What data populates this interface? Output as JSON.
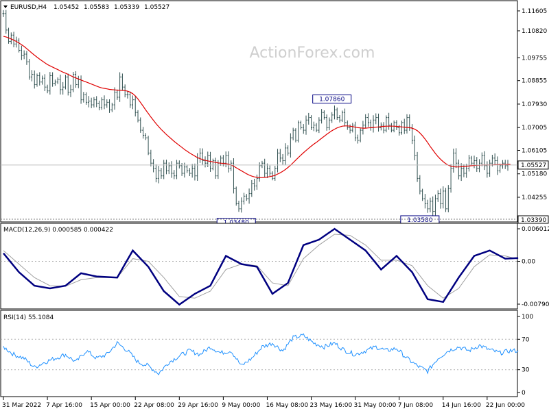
{
  "header": {
    "symbol": "EURUSD,H4",
    "open": "1.05452",
    "high": "1.05583",
    "low": "1.05339",
    "close": "1.05527"
  },
  "watermark": "ActionForex.com",
  "colors": {
    "candle": "#2f4f4f",
    "ma": "#e00000",
    "macd": "#000080",
    "macd_signal": "#a0a0a0",
    "rsi": "#1e90ff",
    "grid_dash": "#b0b0b0",
    "label_box": "#000080"
  },
  "chart_data": [
    {
      "type": "candlestick",
      "name": "price",
      "y_ticks": [
        "1.11605",
        "1.10820",
        "1.09755",
        "1.08855",
        "1.07930",
        "1.07005",
        "1.06105",
        "1.05180",
        "1.04255",
        "1.03390"
      ],
      "ylim": [
        1.0339,
        1.119
      ],
      "current_price": "1.05527",
      "annotations": [
        {
          "label": "1.07860",
          "x_index": 127,
          "value": 1.0786
        },
        {
          "label": "1.03480",
          "x_index": 90,
          "value": 1.0348
        },
        {
          "label": "1.03580",
          "x_index": 161,
          "value": 1.0358
        }
      ],
      "close": [
        1.115,
        1.1085,
        1.104,
        1.1065,
        1.103,
        1.1045,
        1.1005,
        1.0985,
        1.099,
        1.096,
        1.09,
        1.091,
        1.087,
        1.0905,
        1.088,
        1.0895,
        1.086,
        1.0845,
        1.0905,
        1.0875,
        1.088,
        1.089,
        1.085,
        1.086,
        1.09,
        1.084,
        1.085,
        1.091,
        1.087,
        1.089,
        1.081,
        1.083,
        1.08,
        1.0805,
        1.079,
        1.081,
        1.0795,
        1.078,
        1.081,
        1.079,
        1.08,
        1.077,
        1.079,
        1.084,
        1.082,
        1.09,
        1.086,
        1.083,
        1.083,
        1.079,
        1.081,
        1.076,
        1.073,
        1.069,
        1.067,
        1.066,
        1.06,
        1.056,
        1.054,
        1.05,
        1.053,
        1.051,
        1.056,
        1.053,
        1.055,
        1.052,
        1.051,
        1.056,
        1.055,
        1.052,
        1.0545,
        1.053,
        1.052,
        1.054,
        1.051,
        1.058,
        1.06,
        1.057,
        1.056,
        1.059,
        1.054,
        1.057,
        1.051,
        1.056,
        1.058,
        1.056,
        1.059,
        1.054,
        1.056,
        1.046,
        1.04,
        1.038,
        1.041,
        1.043,
        1.042,
        1.044,
        1.048,
        1.047,
        1.05,
        1.055,
        1.056,
        1.052,
        1.054,
        1.052,
        1.05,
        1.054,
        1.06,
        1.058,
        1.057,
        1.062,
        1.06,
        1.066,
        1.069,
        1.065,
        1.072,
        1.07,
        1.069,
        1.073,
        1.074,
        1.07,
        1.071,
        1.069,
        1.073,
        1.076,
        1.074,
        1.07,
        1.073,
        1.075,
        1.077,
        1.074,
        1.073,
        1.076,
        1.072,
        1.07,
        1.069,
        1.071,
        1.066,
        1.065,
        1.069,
        1.071,
        1.074,
        1.072,
        1.07,
        1.073,
        1.074,
        1.07,
        1.071,
        1.069,
        1.074,
        1.071,
        1.069,
        1.072,
        1.07,
        1.068,
        1.072,
        1.069,
        1.074,
        1.07,
        1.065,
        1.059,
        1.05,
        1.045,
        1.042,
        1.04,
        1.038,
        1.041,
        1.037,
        1.042,
        1.044,
        1.04,
        1.045,
        1.038,
        1.046,
        1.054,
        1.06,
        1.056,
        1.051,
        1.054,
        1.052,
        1.054,
        1.058,
        1.056,
        1.057,
        1.054,
        1.056,
        1.059,
        1.055,
        1.052,
        1.056,
        1.058,
        1.057,
        1.053,
        1.055,
        1.056,
        1.055,
        1.0553
      ],
      "ma": [
        1.106,
        1.1058,
        1.1054,
        1.105,
        1.1045,
        1.104,
        1.1034,
        1.1027,
        1.102,
        1.1012,
        1.1003,
        1.0994,
        1.0986,
        1.0978,
        1.097,
        1.0963,
        1.0956,
        1.0949,
        1.0944,
        1.0939,
        1.0934,
        1.0929,
        1.0924,
        1.0919,
        1.0915,
        1.091,
        1.0905,
        1.09,
        1.0896,
        1.0892,
        1.0888,
        1.0884,
        1.088,
        1.0876,
        1.0872,
        1.0868,
        1.0864,
        1.086,
        1.0857,
        1.0855,
        1.0853,
        1.0851,
        1.085,
        1.0849,
        1.0848,
        1.0848,
        1.0847,
        1.0846,
        1.0844,
        1.084,
        1.0834,
        1.0825,
        1.0813,
        1.0799,
        1.0785,
        1.077,
        1.0756,
        1.0742,
        1.0729,
        1.0716,
        1.0704,
        1.0693,
        1.0683,
        1.0673,
        1.0664,
        1.0655,
        1.0646,
        1.0638,
        1.063,
        1.0622,
        1.0614,
        1.0607,
        1.06,
        1.0594,
        1.0588,
        1.0582,
        1.0578,
        1.0574,
        1.0571,
        1.0569,
        1.0567,
        1.0565,
        1.0563,
        1.0561,
        1.056,
        1.0559,
        1.0558,
        1.0556,
        1.0553,
        1.0548,
        1.0542,
        1.0536,
        1.053,
        1.0524,
        1.0518,
        1.0513,
        1.0509,
        1.0506,
        1.0504,
        1.0503,
        1.0503,
        1.0504,
        1.0505,
        1.0507,
        1.0509,
        1.0512,
        1.0517,
        1.0522,
        1.0528,
        1.0535,
        1.0543,
        1.0552,
        1.0562,
        1.0572,
        1.0582,
        1.0592,
        1.0601,
        1.061,
        1.0619,
        1.0627,
        1.0635,
        1.0642,
        1.065,
        1.0658,
        1.0666,
        1.0674,
        1.0681,
        1.0688,
        1.0694,
        1.0699,
        1.0703,
        1.0706,
        1.0707,
        1.0707,
        1.0706,
        1.0704,
        1.0702,
        1.07,
        1.0699,
        1.0698,
        1.0698,
        1.0699,
        1.07,
        1.0701,
        1.0702,
        1.0703,
        1.0704,
        1.0705,
        1.0706,
        1.0706,
        1.0706,
        1.0706,
        1.0705,
        1.0704,
        1.0703,
        1.0702,
        1.0701,
        1.07,
        1.0698,
        1.0694,
        1.0688,
        1.0679,
        1.0668,
        1.0655,
        1.0641,
        1.0626,
        1.0612,
        1.0598,
        1.0586,
        1.0575,
        1.0566,
        1.0558,
        1.0552,
        1.0548,
        1.0546,
        1.0545,
        1.0545,
        1.0546,
        1.0547,
        1.0548,
        1.0549,
        1.055,
        1.0551,
        1.0552,
        1.0552,
        1.0553,
        1.0553,
        1.0553,
        1.0553,
        1.0553,
        1.0554,
        1.0554,
        1.0554,
        1.0554,
        1.0554,
        1.0555,
        1.0555
      ]
    },
    {
      "type": "line",
      "name": "MACD(12,26,9) 0.000585 0.000422",
      "ylim": [
        -0.007907,
        0.006012
      ],
      "y_ticks": [
        "0.006012",
        "0.00",
        "-0.007907"
      ],
      "macd_points": [
        [
          0,
          0.0015
        ],
        [
          6,
          -0.002
        ],
        [
          12,
          -0.0045
        ],
        [
          18,
          -0.005
        ],
        [
          24,
          -0.0045
        ],
        [
          30,
          -0.0022
        ],
        [
          36,
          -0.0028
        ],
        [
          44,
          -0.003
        ],
        [
          50,
          0.002
        ],
        [
          56,
          -0.001
        ],
        [
          62,
          -0.0055
        ],
        [
          68,
          -0.008
        ],
        [
          74,
          -0.006
        ],
        [
          80,
          -0.0045
        ],
        [
          86,
          0.001
        ],
        [
          92,
          -0.0005
        ],
        [
          98,
          -0.001
        ],
        [
          104,
          -0.006
        ],
        [
          110,
          -0.004
        ],
        [
          116,
          0.003
        ],
        [
          122,
          0.004
        ],
        [
          128,
          0.006
        ],
        [
          134,
          0.004
        ],
        [
          140,
          0.002
        ],
        [
          146,
          -0.0015
        ],
        [
          152,
          0.001
        ],
        [
          158,
          -0.002
        ],
        [
          164,
          -0.007
        ],
        [
          170,
          -0.0075
        ],
        [
          176,
          -0.003
        ],
        [
          182,
          0.001
        ],
        [
          188,
          0.002
        ],
        [
          194,
          0.0005
        ],
        [
          199,
          0.0006
        ]
      ],
      "signal_points": [
        [
          0,
          0.002
        ],
        [
          6,
          -0.0005
        ],
        [
          12,
          -0.003
        ],
        [
          18,
          -0.0045
        ],
        [
          24,
          -0.0046
        ],
        [
          30,
          -0.0034
        ],
        [
          36,
          -0.003
        ],
        [
          44,
          -0.003
        ],
        [
          50,
          0.0005
        ],
        [
          56,
          0.0
        ],
        [
          62,
          -0.003
        ],
        [
          68,
          -0.0065
        ],
        [
          74,
          -0.0068
        ],
        [
          80,
          -0.0055
        ],
        [
          86,
          -0.0015
        ],
        [
          92,
          -0.0005
        ],
        [
          98,
          -0.0008
        ],
        [
          104,
          -0.004
        ],
        [
          110,
          -0.0045
        ],
        [
          116,
          0.0005
        ],
        [
          122,
          0.003
        ],
        [
          128,
          0.005
        ],
        [
          134,
          0.0048
        ],
        [
          140,
          0.003
        ],
        [
          146,
          0.0002
        ],
        [
          152,
          0.0002
        ],
        [
          158,
          -0.0008
        ],
        [
          164,
          -0.0045
        ],
        [
          170,
          -0.0068
        ],
        [
          176,
          -0.005
        ],
        [
          182,
          -0.001
        ],
        [
          188,
          0.0012
        ],
        [
          194,
          0.001
        ],
        [
          199,
          0.0004
        ]
      ]
    },
    {
      "type": "line",
      "name": "RSI(14) 55.1084",
      "ylim": [
        0,
        100
      ],
      "y_ticks": [
        "100",
        "70",
        "30",
        "0"
      ],
      "levels": [
        70,
        30
      ],
      "points": [
        [
          0,
          60
        ],
        [
          4,
          50
        ],
        [
          8,
          45
        ],
        [
          12,
          33
        ],
        [
          16,
          40
        ],
        [
          20,
          45
        ],
        [
          24,
          50
        ],
        [
          28,
          40
        ],
        [
          32,
          55
        ],
        [
          36,
          45
        ],
        [
          40,
          50
        ],
        [
          44,
          65
        ],
        [
          48,
          55
        ],
        [
          52,
          40
        ],
        [
          56,
          35
        ],
        [
          60,
          25
        ],
        [
          64,
          40
        ],
        [
          68,
          48
        ],
        [
          72,
          55
        ],
        [
          76,
          50
        ],
        [
          80,
          60
        ],
        [
          84,
          52
        ],
        [
          88,
          55
        ],
        [
          92,
          35
        ],
        [
          96,
          45
        ],
        [
          100,
          60
        ],
        [
          104,
          65
        ],
        [
          108,
          55
        ],
        [
          112,
          72
        ],
        [
          116,
          75
        ],
        [
          120,
          65
        ],
        [
          124,
          60
        ],
        [
          128,
          65
        ],
        [
          132,
          55
        ],
        [
          136,
          50
        ],
        [
          140,
          55
        ],
        [
          144,
          60
        ],
        [
          148,
          55
        ],
        [
          152,
          58
        ],
        [
          156,
          45
        ],
        [
          160,
          35
        ],
        [
          164,
          28
        ],
        [
          168,
          45
        ],
        [
          172,
          55
        ],
        [
          176,
          60
        ],
        [
          180,
          55
        ],
        [
          184,
          62
        ],
        [
          188,
          56
        ],
        [
          192,
          52
        ],
        [
          196,
          55
        ],
        [
          199,
          55
        ]
      ]
    }
  ],
  "x_axis": {
    "labels": [
      {
        "text": "31 Mar 2022",
        "index": 0
      },
      {
        "text": "7 Apr 16:00",
        "index": 17
      },
      {
        "text": "15 Apr 00:00",
        "index": 34
      },
      {
        "text": "22 Apr 08:00",
        "index": 51
      },
      {
        "text": "29 Apr 16:00",
        "index": 68
      },
      {
        "text": "9 May 00:00",
        "index": 85
      },
      {
        "text": "16 May 08:00",
        "index": 102
      },
      {
        "text": "23 May 16:00",
        "index": 119
      },
      {
        "text": "31 May 00:00",
        "index": 136
      },
      {
        "text": "7 Jun 08:00",
        "index": 153
      },
      {
        "text": "14 Jun 16:00",
        "index": 170
      },
      {
        "text": "22 Jun 00:00",
        "index": 187
      }
    ]
  }
}
